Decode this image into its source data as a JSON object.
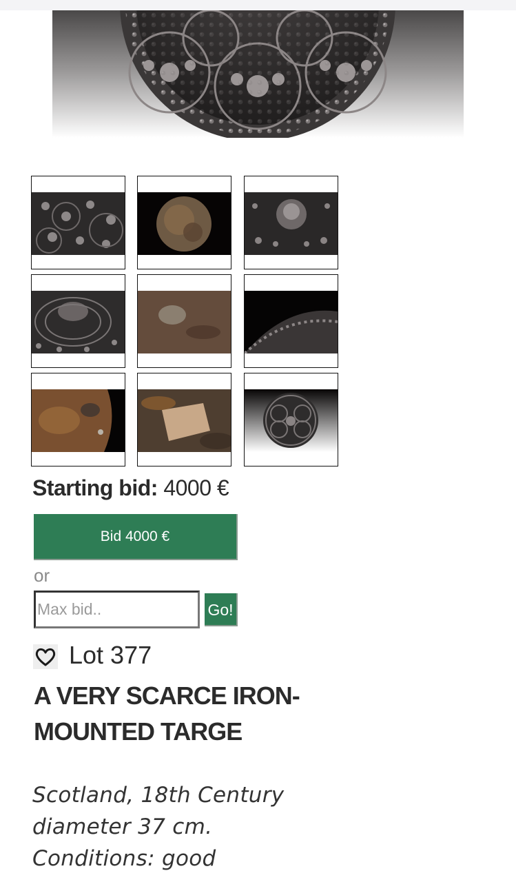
{
  "gallery": {
    "main_image": "targe-front-detail",
    "thumbnails": [
      "targe-ornament-detail",
      "targe-rusted-back",
      "targe-boss-detail",
      "targe-boss-side",
      "targe-back-detail",
      "targe-rim-detail",
      "targe-rusted-edge",
      "targe-rusted-center",
      "targe-full-front"
    ]
  },
  "bidding": {
    "starting_label": "Starting bid:",
    "starting_value": "4000 €",
    "bid_button": "Bid 4000 €",
    "or_text": "or",
    "max_bid_placeholder": "Max bid..",
    "go_button": "Go!"
  },
  "lot": {
    "favorite_icon": "heart-outline-icon",
    "number": "Lot 377",
    "title": "A VERY SCARCE IRON-MOUNTED TARGE",
    "description": [
      "Scotland, 18th Century",
      "diameter 37 cm.",
      "Conditions: good"
    ]
  },
  "colors": {
    "accent": "#2e7d55",
    "text": "#2b2b2b"
  }
}
